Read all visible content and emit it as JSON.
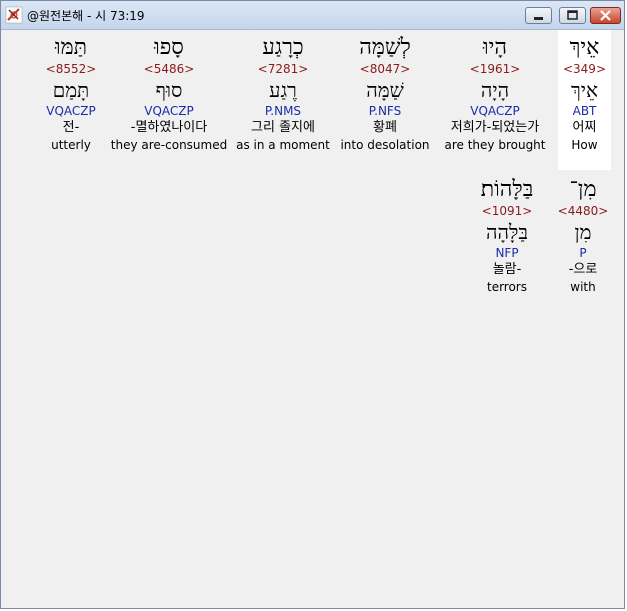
{
  "window": {
    "title": "@원전본해 - 시 73:19"
  },
  "words": [
    {
      "hebrew": "אֵיךְ",
      "strong": "<349>",
      "lemma": "אֵיךְ",
      "morph": "ABT",
      "korean": "어찌",
      "english": "How",
      "highlighted": true
    },
    {
      "hebrew": "הָיוּ",
      "strong": "<1961>",
      "lemma": "הָיָה",
      "morph": "VQACZP",
      "korean": "저희가-되었는가",
      "english": "are they brought",
      "highlighted": false
    },
    {
      "hebrew": "לְשַׁמָּה",
      "strong": "<8047>",
      "lemma": "שַׁמָּה",
      "morph": "P.NFS",
      "korean": "황폐",
      "english": "into desolation",
      "highlighted": false
    },
    {
      "hebrew": "כְרָגַע",
      "strong": "<7281>",
      "lemma": "רֶגַע",
      "morph": "P.NMS",
      "korean": "그리 졸지에",
      "english": "as in a moment",
      "highlighted": false
    },
    {
      "hebrew": "סָפוּ",
      "strong": "<5486>",
      "lemma": "סוּף",
      "morph": "VQACZP",
      "korean": "-멸하였나이다",
      "english": "they are-consumed",
      "highlighted": false
    },
    {
      "hebrew": "תַּמּוּ",
      "strong": "<8552>",
      "lemma": "תָּמַם",
      "morph": "VQACZP",
      "korean": "전-",
      "english": "utterly",
      "highlighted": false
    },
    {
      "hebrew": "מִן־",
      "strong": "<4480>",
      "lemma": "מִן",
      "morph": "P",
      "korean": "-으로",
      "english": "with",
      "highlighted": false
    },
    {
      "hebrew": "בַּלָּהוֹת׃",
      "strong": "<1091>",
      "lemma": "בַּלָּהָה",
      "morph": "NFP",
      "korean": "놀람-",
      "english": "terrors",
      "highlighted": false
    }
  ]
}
